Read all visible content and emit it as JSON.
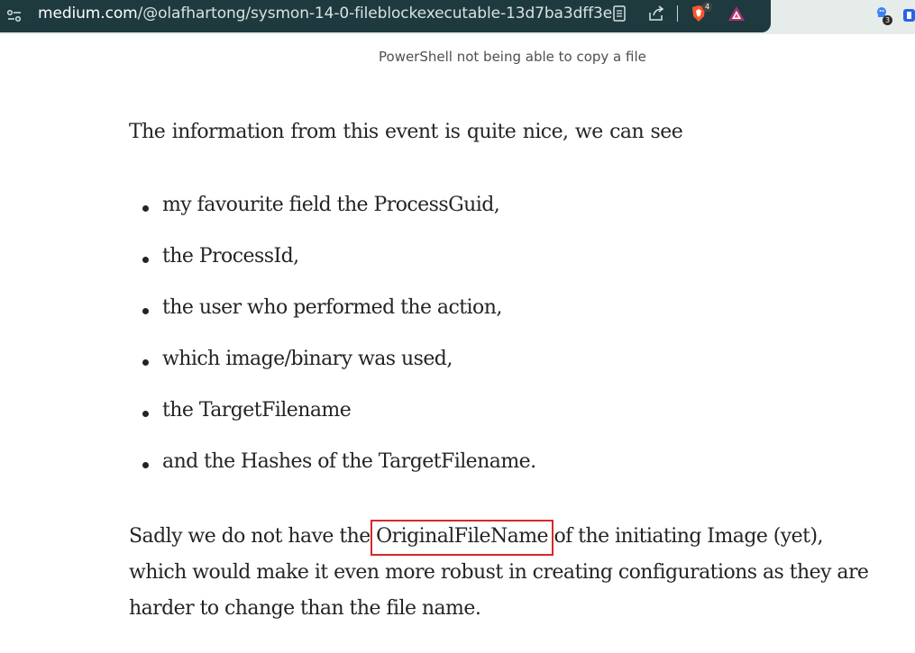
{
  "browser": {
    "url_host": "medium.com",
    "url_path": "/@olafhartong/sysmon-14-0-fileblockexecutable-13d7ba3dff3e",
    "brave_shields_count": "4",
    "extension_badge_count": "3",
    "icons": [
      "site-info-icon",
      "reader-mode-icon",
      "share-icon",
      "brave-shields-icon",
      "brave-rewards-icon",
      "extension-icon",
      "extension-icon-2"
    ]
  },
  "article": {
    "image_caption": "PowerShell not being able to copy a file",
    "intro": "The information from this event is quite nice, we can see",
    "bullets": [
      "my favourite field the ProcessGuid,",
      "the ProcessId,",
      "the user who performed the action,",
      "which image/binary was used,",
      "the TargetFilename",
      "and the Hashes of the TargetFilename."
    ],
    "closing_line_1_prefix": "Sadly we do not have the ",
    "closing_highlight": "OriginalFileName",
    "closing_line_1_suffix": " of the initiating Image (yet),",
    "closing_line_2": "which would make it even more robust in creating configurations as they are",
    "closing_line_3": "harder to change than the file name."
  },
  "colors": {
    "urlbar_bg": "#1f3a3f",
    "text": "#242424",
    "highlight_border": "#d42a2a"
  }
}
